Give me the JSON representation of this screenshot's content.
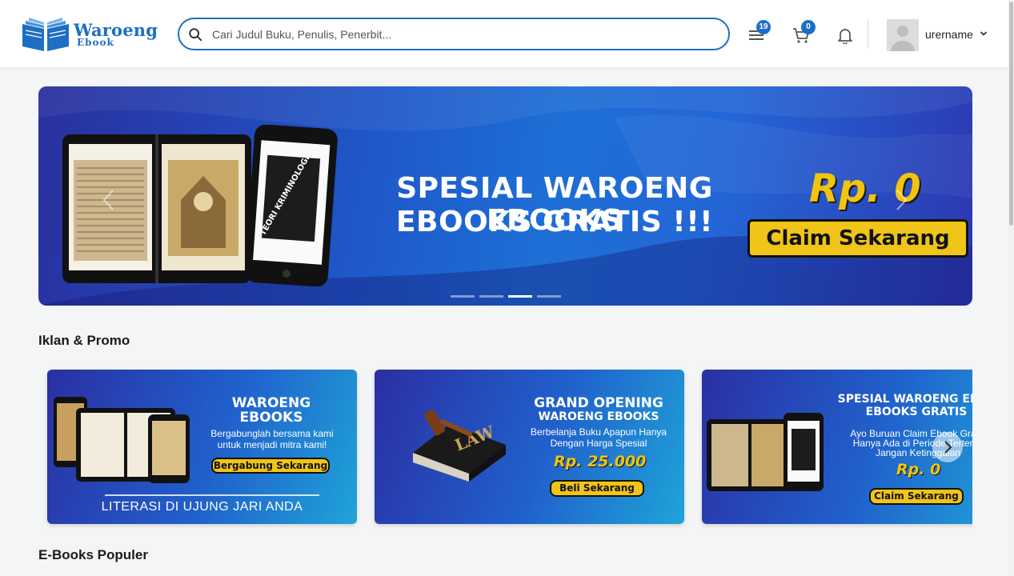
{
  "brand": {
    "name": "Waroeng",
    "sub": "Ebook",
    "color": "#1d6fc4"
  },
  "search": {
    "placeholder": "Cari Judul Buku, Penulis, Penerbit..."
  },
  "header": {
    "menu_badge": "19",
    "cart_badge": "0",
    "username": "urername"
  },
  "hero": {
    "headline_1": "SPESIAL WAROENG EBOOKS",
    "headline_2": "EBOOKS GRATIS !!!",
    "price": "Rp. 0",
    "cta": "Claim Sekarang",
    "slides": 4,
    "active_slide": 3
  },
  "sections": {
    "promo_title": "Iklan & Promo",
    "popular_title": "E-Books Populer"
  },
  "promos": [
    {
      "title_1": "WAROENG",
      "title_2": "EBOOKS",
      "desc_1": "Bergabunglah bersama kami",
      "desc_2": "untuk menjadi mitra kami!",
      "button": "Bergabung Sekarang",
      "footer": "LITERASI DI UJUNG JARI ANDA"
    },
    {
      "title_1": "GRAND OPENING",
      "title_2": "WAROENG EBOOKS",
      "desc_1": "Berbelanja Buku Apapun Hanya",
      "desc_2": "Dengan Harga Spesial",
      "price": "Rp. 25.000",
      "button": "Beli Sekarang"
    },
    {
      "title_1": "SPESIAL WAROENG EBOOKS",
      "title_2": "EBOOKS GRATIS !!!",
      "desc_1": "Ayo Buruan Claim Ebook Gratis",
      "desc_2": "Hanya Ada di Periode Tertentu",
      "desc_3": "Jangan Ketinggalan",
      "price": "Rp. 0",
      "button": "Claim Sekarang"
    }
  ],
  "colors": {
    "accent": "#1d6fc4",
    "cta_yellow": "#f0c419",
    "banner_blue": "#1f57c8"
  }
}
